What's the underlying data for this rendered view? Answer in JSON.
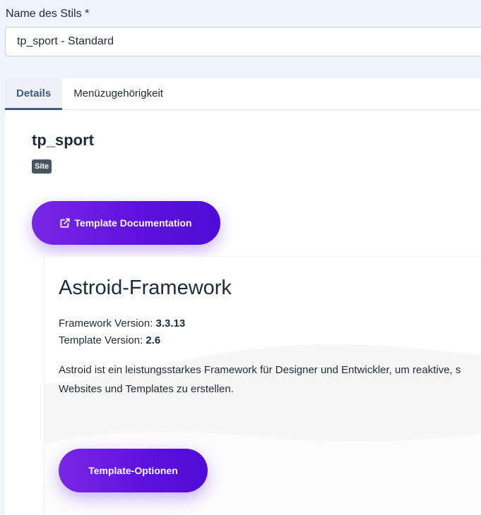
{
  "form": {
    "style_name_label": "Name des Stils *",
    "style_name_value": "tp_sport - Standard"
  },
  "tabs": [
    {
      "label": "Details",
      "active": true
    },
    {
      "label": "Menüzugehörigkeit",
      "active": false
    }
  ],
  "details": {
    "template_name": "tp_sport",
    "badge": "Site",
    "doc_button_label": "Template Documentation",
    "doc_button_icon": "external-link-icon"
  },
  "astroid": {
    "title": "Astroid-Framework",
    "framework_version_label": "Framework Version:",
    "framework_version_value": "3.3.13",
    "template_version_label": "Template Version:",
    "template_version_value": "2.6",
    "description_line1": "Astroid ist ein leistungsstarkes Framework für Designer und Entwickler, um reaktive, s",
    "description_line2": "Websites und Templates zu erstellen.",
    "options_button_label": "Template-Optionen"
  },
  "colors": {
    "accent_purple": "#5d11dc",
    "tab_active": "#3f5a7d",
    "badge_bg": "#4a5563",
    "page_bg": "#f0f4fb"
  }
}
